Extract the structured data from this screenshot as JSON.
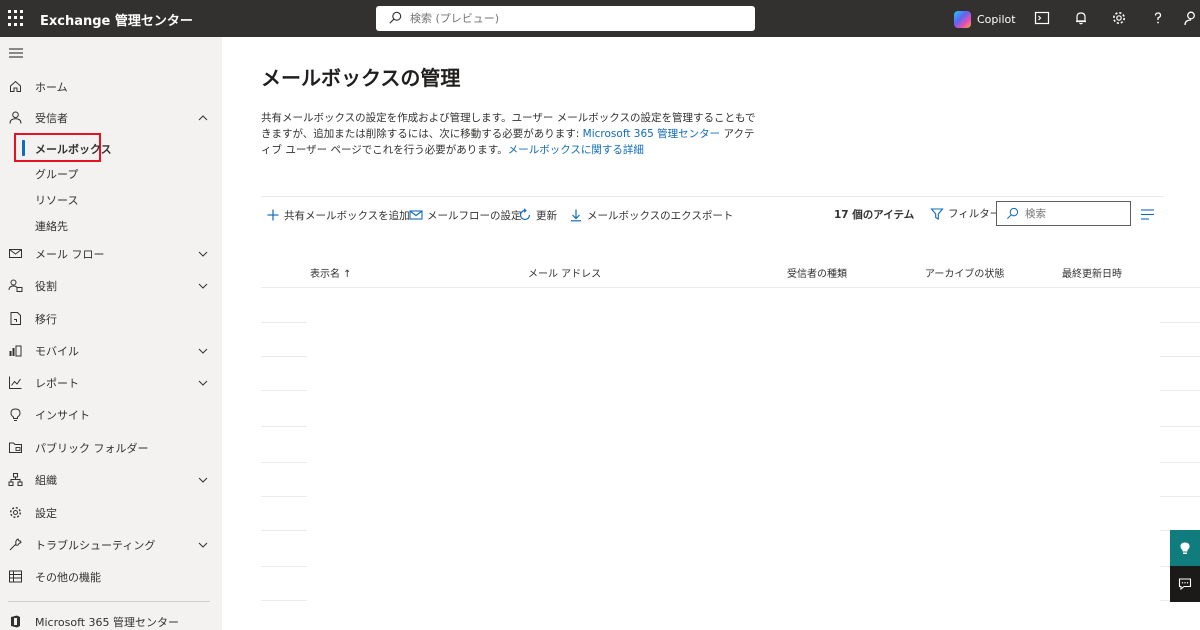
{
  "topbar": {
    "app_title": "Exchange 管理センター",
    "search_placeholder": "検索 (プレビュー)",
    "copilot_label": "Copilot",
    "icons": [
      "app-launcher-icon",
      "search-icon",
      "copilot-icon",
      "terminal-icon",
      "bell-icon",
      "gear-icon",
      "help-icon",
      "person-icon"
    ],
    "background_color": "#323130"
  },
  "nav": {
    "background_color": "#f3f2f1",
    "items": [
      {
        "label": "ホーム",
        "icon": "home-icon",
        "expandable": false
      },
      {
        "label": "受信者",
        "icon": "person-icon",
        "expandable": true,
        "expanded": true,
        "children": [
          {
            "label": "メールボックス",
            "selected": true
          },
          {
            "label": "グループ",
            "selected": false
          },
          {
            "label": "リソース",
            "selected": false
          },
          {
            "label": "連絡先",
            "selected": false
          }
        ]
      },
      {
        "label": "メール フロー",
        "icon": "mail-icon",
        "expandable": true
      },
      {
        "label": "役割",
        "icon": "roles-icon",
        "expandable": true
      },
      {
        "label": "移行",
        "icon": "migration-icon",
        "expandable": false
      },
      {
        "label": "モバイル",
        "icon": "mobile-icon",
        "expandable": true
      },
      {
        "label": "レポート",
        "icon": "chart-icon",
        "expandable": true
      },
      {
        "label": "インサイト",
        "icon": "lightbulb-icon",
        "expandable": false
      },
      {
        "label": "パブリック フォルダー",
        "icon": "folder-icon",
        "expandable": false
      },
      {
        "label": "組織",
        "icon": "org-icon",
        "expandable": true
      },
      {
        "label": "設定",
        "icon": "gear-icon",
        "expandable": false
      },
      {
        "label": "トラブルシューティング",
        "icon": "wrench-icon",
        "expandable": true
      },
      {
        "label": "その他の機能",
        "icon": "table-icon",
        "expandable": false
      }
    ],
    "footer_link": {
      "label": "Microsoft 365 管理センター",
      "icon": "office-icon"
    }
  },
  "main": {
    "title": "メールボックスの管理",
    "description": {
      "part1": "共有メールボックスの設定を作成および管理します。ユーザー メールボックスの設定を管理することもできますが、追加または削除するには、次に移動する必要があります: ",
      "link1": "Microsoft 365 管理センター",
      "part2": " アクティブ ユーザー ページでこれを行う必要があります。",
      "link2": "メールボックスに関する詳細"
    },
    "toolbar": {
      "add_shared": "共有メールボックスを追加",
      "mail_flow_settings": "メールフローの設定",
      "refresh": "更新",
      "export": "メールボックスのエクスポート",
      "item_count": "17 個のアイテム",
      "filter": "フィルター",
      "search_placeholder": "検索"
    },
    "columns": [
      "表示名 ↑",
      "メール アドレス",
      "受信者の種類",
      "アーカイブの状態",
      "最終更新日時"
    ],
    "accent_color": "#0f6cbd"
  }
}
